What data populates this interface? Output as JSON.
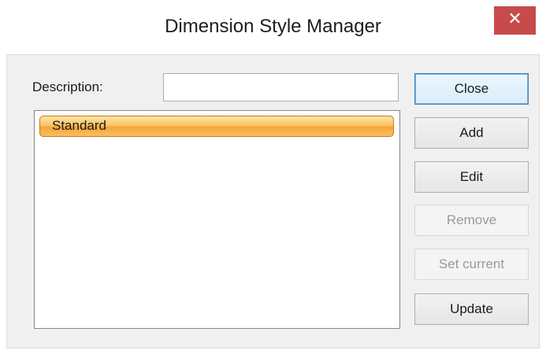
{
  "window": {
    "title": "Dimension Style Manager",
    "close_glyph": "✕"
  },
  "description": {
    "label": "Description:",
    "value": ""
  },
  "styles_list": {
    "items": [
      {
        "label": "Standard",
        "selected": true
      }
    ]
  },
  "buttons": {
    "close": {
      "label": "Close",
      "enabled": true,
      "default": true
    },
    "add": {
      "label": "Add",
      "enabled": true
    },
    "edit": {
      "label": "Edit",
      "enabled": true
    },
    "remove": {
      "label": "Remove",
      "enabled": false
    },
    "set_current": {
      "label": "Set current",
      "enabled": false
    },
    "update": {
      "label": "Update",
      "enabled": true
    }
  },
  "colors": {
    "close_button_red": "#c74b4b",
    "selection_orange": "#f6a637",
    "dialog_background": "#f0f0f0"
  }
}
